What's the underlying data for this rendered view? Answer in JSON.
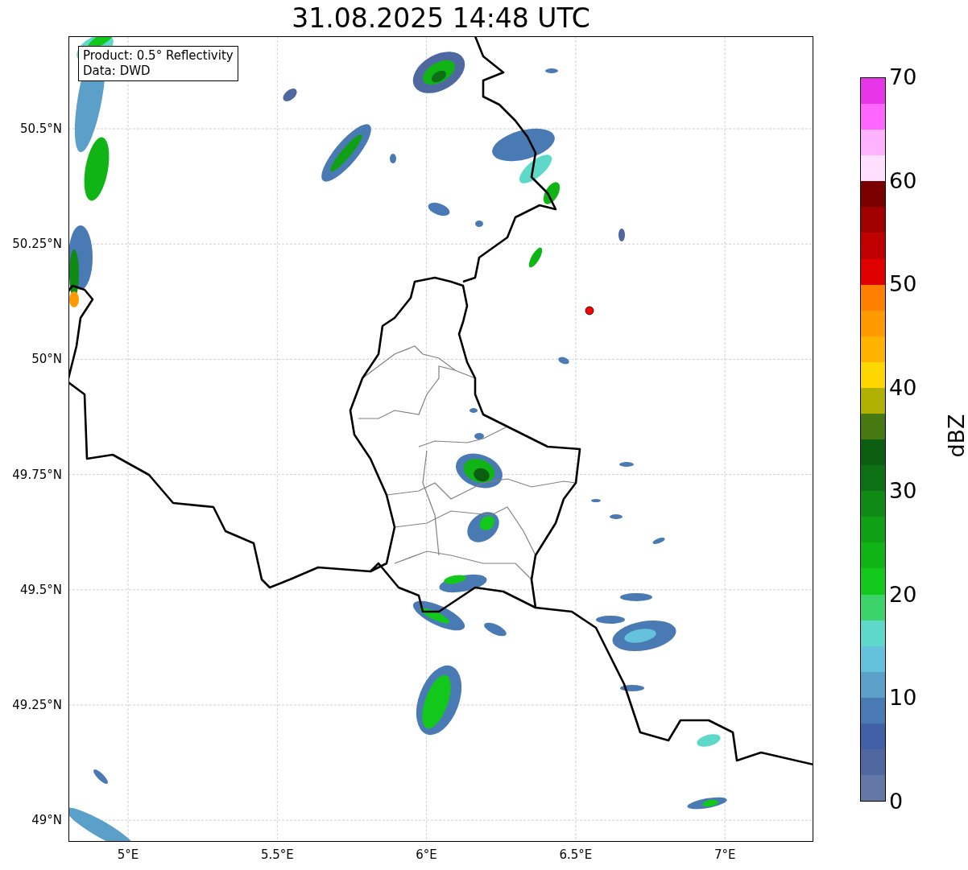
{
  "title": "31.08.2025 14:48 UTC",
  "info_box": [
    "Product: 0.5° Reflectivity",
    "Data: DWD"
  ],
  "map": {
    "lat_ticks": [
      "50.5°N",
      "50.25°N",
      "50°N",
      "49.75°N",
      "49.5°N",
      "49.25°N",
      "49°N"
    ],
    "lon_ticks": [
      "5°E",
      "5.5°E",
      "6°E",
      "6.5°E",
      "7°E"
    ]
  },
  "colorbar": {
    "label": "dBZ",
    "ticks": [
      "70",
      "60",
      "50",
      "40",
      "30",
      "20",
      "10",
      "0"
    ],
    "bands": [
      {
        "color": "#e835e8"
      },
      {
        "color": "#ff66ff"
      },
      {
        "color": "#ffb3ff"
      },
      {
        "color": "#ffe0ff"
      },
      {
        "color": "#7a0000"
      },
      {
        "color": "#a00000"
      },
      {
        "color": "#c00000"
      },
      {
        "color": "#e00000"
      },
      {
        "color": "#ff7f00"
      },
      {
        "color": "#ff9900"
      },
      {
        "color": "#ffb300"
      },
      {
        "color": "#ffd700"
      },
      {
        "color": "#b0b000"
      },
      {
        "color": "#467a10"
      },
      {
        "color": "#0b5e10"
      },
      {
        "color": "#0d7015"
      },
      {
        "color": "#0f8a15"
      },
      {
        "color": "#10a015"
      },
      {
        "color": "#10b515"
      },
      {
        "color": "#12c81a"
      },
      {
        "color": "#3cd46a"
      },
      {
        "color": "#5ed8c8"
      },
      {
        "color": "#64c2dc"
      },
      {
        "color": "#5aa0c8"
      },
      {
        "color": "#4a7ab4"
      },
      {
        "color": "#4160a8"
      },
      {
        "color": "#5068a0"
      },
      {
        "color": "#6478a8"
      }
    ]
  }
}
